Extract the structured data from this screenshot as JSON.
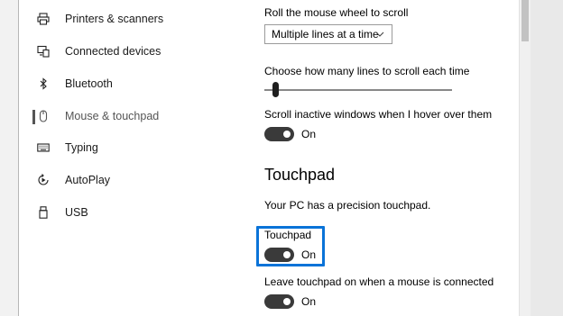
{
  "sidebar": {
    "items": [
      {
        "label": "Printers & scanners",
        "icon": "printer-icon",
        "active": false
      },
      {
        "label": "Connected devices",
        "icon": "connected-devices-icon",
        "active": false
      },
      {
        "label": "Bluetooth",
        "icon": "bluetooth-icon",
        "active": false
      },
      {
        "label": "Mouse & touchpad",
        "icon": "mouse-icon",
        "active": true
      },
      {
        "label": "Typing",
        "icon": "keyboard-icon",
        "active": false
      },
      {
        "label": "AutoPlay",
        "icon": "autoplay-icon",
        "active": false
      },
      {
        "label": "USB",
        "icon": "usb-icon",
        "active": false
      }
    ]
  },
  "main": {
    "scroll_wheel": {
      "label": "Roll the mouse wheel to scroll",
      "selected": "Multiple lines at a time"
    },
    "lines_slider": {
      "label": "Choose how many lines to scroll each time",
      "value_fraction": 0.03
    },
    "scroll_inactive": {
      "label": "Scroll inactive windows when I hover over them",
      "state": "On"
    },
    "touchpad_section": {
      "title": "Touchpad",
      "description": "Your PC has a precision touchpad."
    },
    "touchpad_toggle": {
      "label": "Touchpad",
      "state": "On"
    },
    "leave_touchpad": {
      "label": "Leave touchpad on when a mouse is connected",
      "state": "On"
    }
  },
  "colors": {
    "accent": "#0a73d8",
    "toggle_on": "#3a3a3a"
  }
}
